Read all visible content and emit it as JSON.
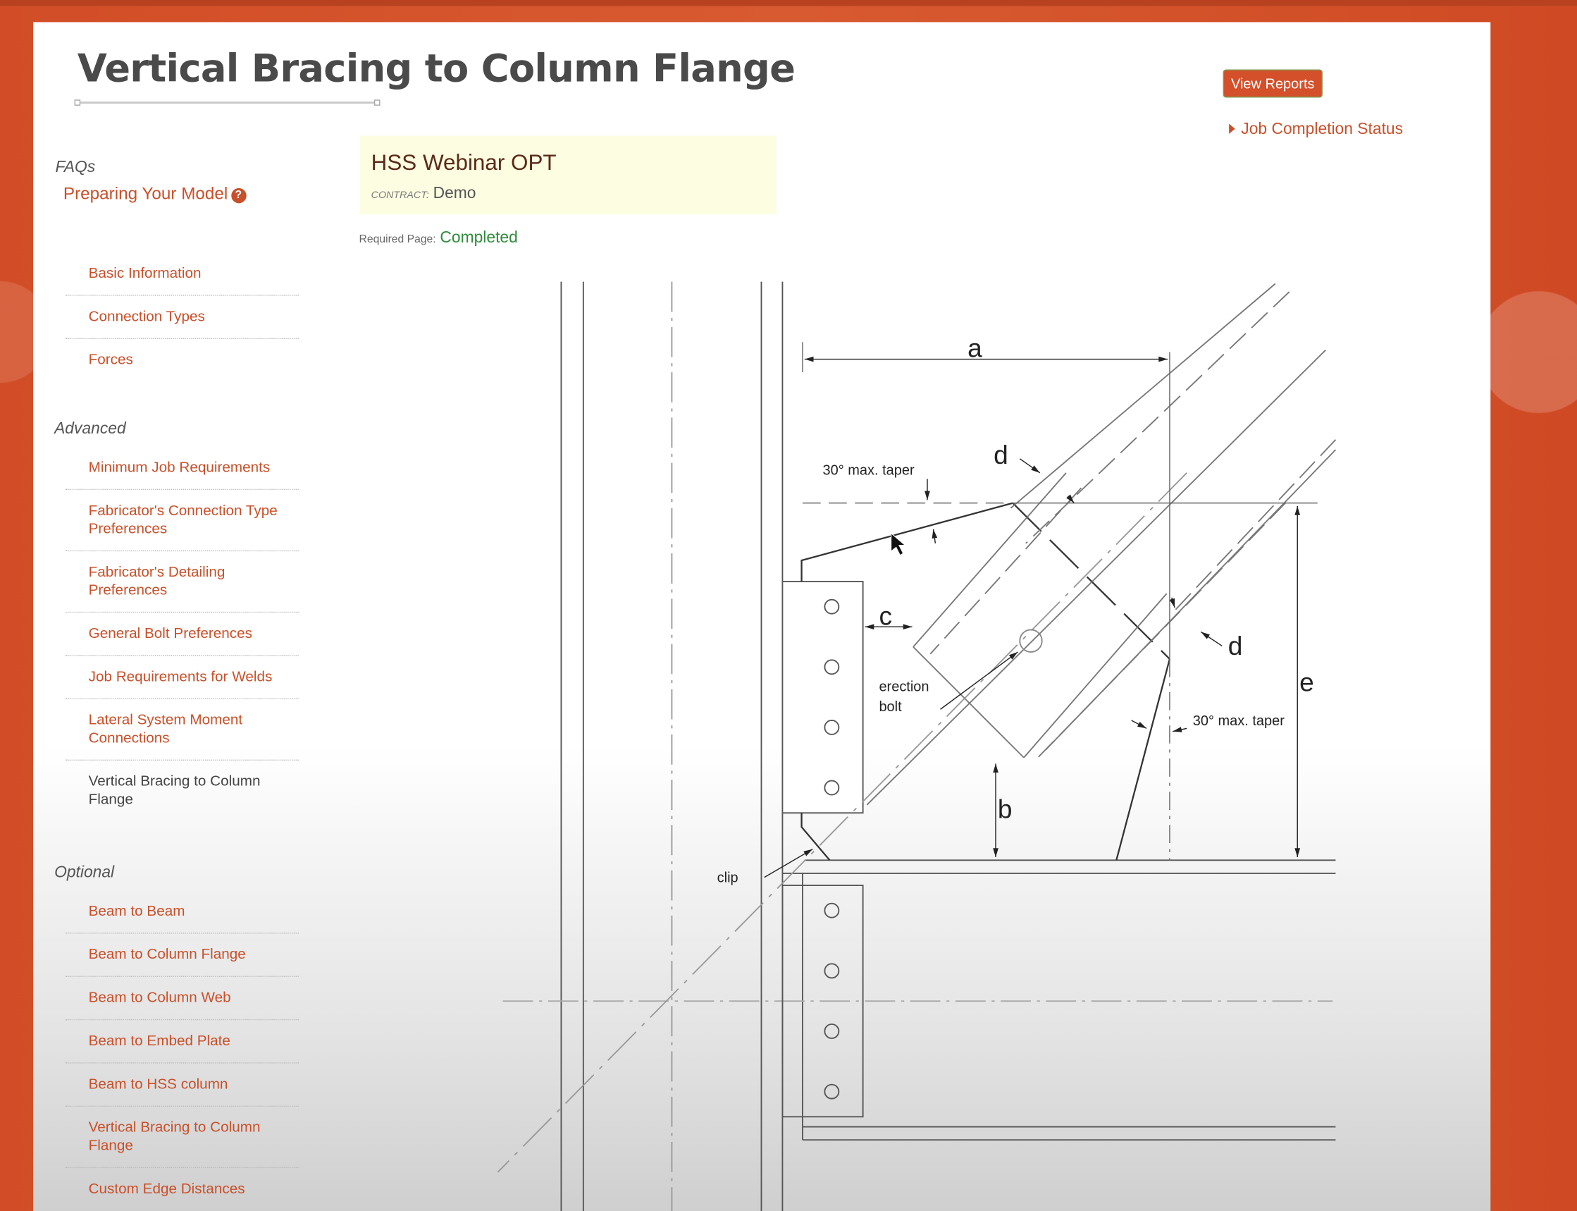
{
  "page_title": "Vertical Bracing to Column Flange",
  "header": {
    "view_reports_label": "View Reports",
    "job_completion_status_label": "Job Completion Status"
  },
  "job": {
    "name": "HSS Webinar OPT",
    "contract_label": "CONTRACT:",
    "contract_value": "Demo"
  },
  "required_page": {
    "label": "Required Page:",
    "status": "Completed"
  },
  "sidebar": {
    "faqs_heading": "FAQs",
    "faq_link": "Preparing Your Model",
    "basic_items": [
      "Basic Information",
      "Connection Types",
      "Forces"
    ],
    "advanced_heading": "Advanced",
    "advanced_items": [
      "Minimum Job Requirements",
      "Fabricator's Connection Type Preferences",
      "Fabricator's Detailing Preferences",
      "General Bolt Preferences",
      "Job Requirements for Welds",
      "Lateral System Moment Connections",
      "Vertical Bracing to Column Flange"
    ],
    "advanced_current_index": 6,
    "optional_heading": "Optional",
    "optional_items": [
      "Beam to Beam",
      "Beam to Column Flange",
      "Beam to Column Web",
      "Beam to Embed Plate",
      "Beam to HSS column",
      "Vertical Bracing to Column Flange",
      "Custom Edge Distances"
    ]
  },
  "diagram": {
    "labels": {
      "a": "a",
      "b": "b",
      "c": "c",
      "d": "d",
      "e": "e",
      "taper": "30° max. taper",
      "erection": "erection",
      "bolt": "bolt",
      "clip": "clip"
    }
  },
  "colors": {
    "brand": "#d4502a",
    "link": "#c8502a",
    "completed": "#2e8b3a",
    "job_card_bg": "#fdfde2"
  },
  "icons": {
    "help": "question-circle-icon",
    "expand": "caret-right-icon"
  }
}
